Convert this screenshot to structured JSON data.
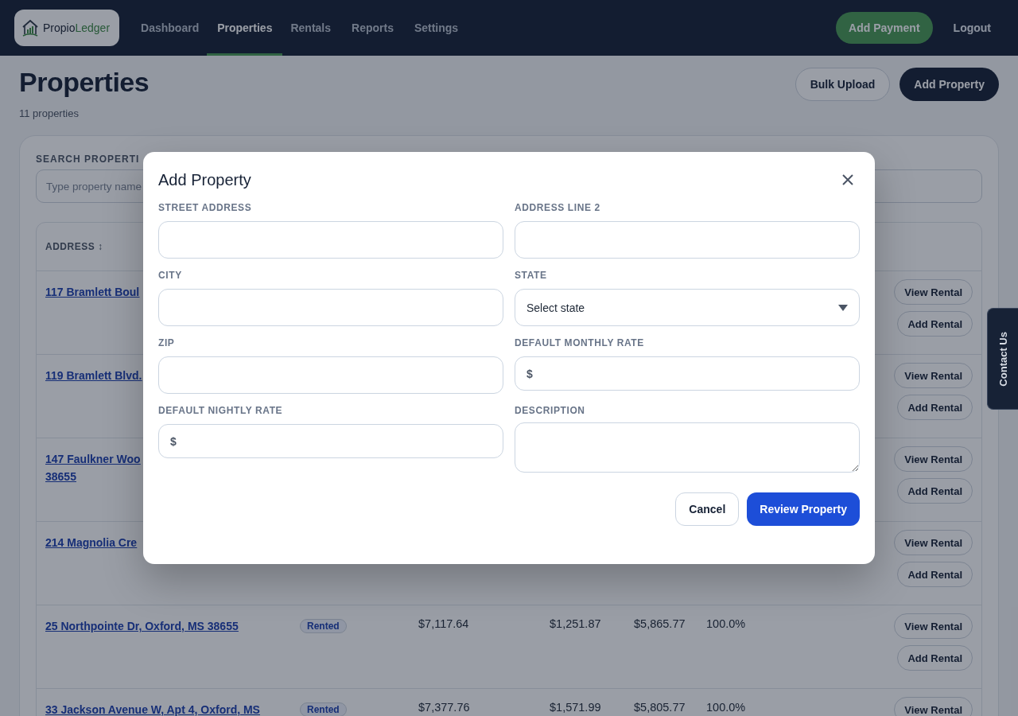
{
  "header": {
    "logo": {
      "part_1": "Propio",
      "part_2": "Ledger"
    },
    "nav": [
      {
        "label": "Dashboard",
        "selected": false
      },
      {
        "label": "Properties",
        "selected": true
      },
      {
        "label": "Rentals",
        "selected": false
      },
      {
        "label": "Reports",
        "selected": false
      },
      {
        "label": "Settings",
        "selected": false
      }
    ],
    "actions": [
      {
        "label": "Add Payment",
        "kind": "primary"
      },
      {
        "label": "Logout",
        "kind": "plain"
      }
    ]
  },
  "page": {
    "title": "Properties",
    "subtitle": "11 properties",
    "buttons": [
      {
        "label": "Bulk Upload",
        "kind": "outline"
      },
      {
        "label": "Add Property",
        "kind": "dark"
      }
    ],
    "search": {
      "label": "SEARCH PROPERTI",
      "placeholder": "Type property name"
    },
    "table": {
      "columns": [
        {
          "label": "ADDRESS",
          "sort_icon": "↕"
        }
      ],
      "rows": [
        {
          "address": [
            "117 Bramlett Boul"
          ],
          "actions": [
            "View Rental",
            "Add Rental"
          ]
        },
        {
          "address": [
            "119 Bramlett Blvd."
          ],
          "actions": [
            "View Rental",
            "Add Rental"
          ]
        },
        {
          "address": [
            "147 Faulkner Woo",
            "38655"
          ],
          "actions": [
            "View Rental",
            "Add Rental"
          ]
        },
        {
          "address": [
            "214 Magnolia Cre"
          ],
          "actions": [
            "View Rental",
            "Add Rental"
          ]
        },
        {
          "address": [
            "25 Northpointe Dr, Oxford, MS 38655"
          ],
          "status": "Rented",
          "cells": [
            "$7,117.64",
            "$1,251.87",
            "$5,865.77",
            "100.0%"
          ],
          "actions": [
            "View Rental",
            "Add Rental"
          ]
        },
        {
          "address": [
            "33 Jackson Avenue W, Apt 4, Oxford, MS"
          ],
          "status": "Rented",
          "cells": [
            "$7,377.76",
            "$1,571.99",
            "$5,805.77",
            "100.0%"
          ],
          "actions": [
            "View Rental"
          ]
        }
      ]
    }
  },
  "contact_tab": {
    "label": "Contact Us"
  },
  "dialog": {
    "title": "Add Property",
    "fields": [
      {
        "label": "STREET ADDRESS",
        "kind": "text"
      },
      {
        "label": "ADDRESS LINE 2",
        "kind": "text"
      },
      {
        "label": "CITY",
        "kind": "text"
      },
      {
        "label": "STATE",
        "kind": "select",
        "value": "Select state"
      },
      {
        "label": "ZIP",
        "kind": "text"
      },
      {
        "label": "DEFAULT MONTHLY RATE",
        "kind": "currency",
        "prefix": "$"
      },
      {
        "label": "DEFAULT NIGHTLY RATE",
        "kind": "currency",
        "prefix": "$"
      },
      {
        "label": "DESCRIPTION",
        "kind": "textarea"
      }
    ],
    "buttons": [
      {
        "label": "Cancel",
        "kind": "secondary"
      },
      {
        "label": "Review Property",
        "kind": "primary"
      }
    ]
  }
}
